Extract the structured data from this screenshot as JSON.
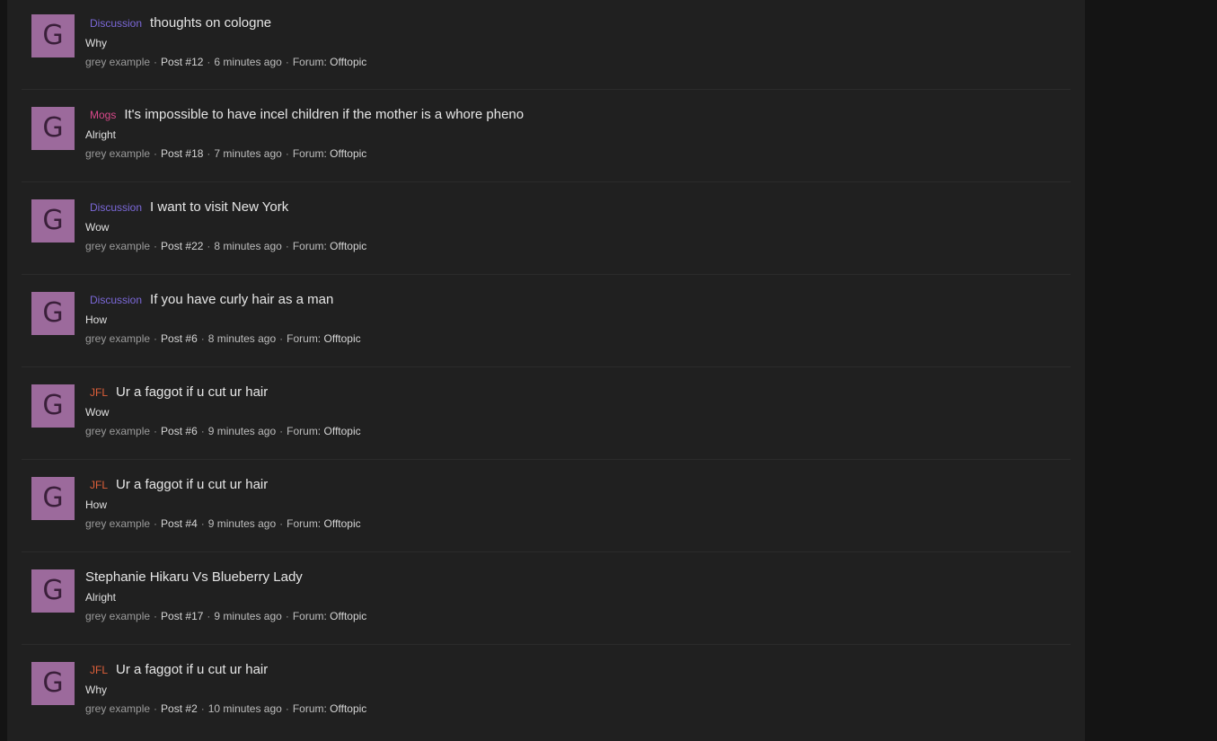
{
  "colors": {
    "page_background": "#141414",
    "panel_background": "#202020",
    "avatar_background": "#9c6a9c",
    "prefix_discussion": "#7b68d8",
    "prefix_mogs": "#d8488a",
    "prefix_jfl": "#e0603a"
  },
  "results": [
    {
      "avatar_letter": "G",
      "prefix": "Discussion",
      "prefix_type": "discussion",
      "title": "thoughts on cologne",
      "snippet": "Why",
      "author": "grey example",
      "post": "Post #12",
      "time": "6 minutes ago",
      "forum_label": "Forum:",
      "forum": "Offtopic"
    },
    {
      "avatar_letter": "G",
      "prefix": "Mogs",
      "prefix_type": "mogs",
      "title": "It's impossible to have incel children if the mother is a whore pheno",
      "snippet": "Alright",
      "author": "grey example",
      "post": "Post #18",
      "time": "7 minutes ago",
      "forum_label": "Forum:",
      "forum": "Offtopic"
    },
    {
      "avatar_letter": "G",
      "prefix": "Discussion",
      "prefix_type": "discussion",
      "title": "I want to visit New York",
      "snippet": "Wow",
      "author": "grey example",
      "post": "Post #22",
      "time": "8 minutes ago",
      "forum_label": "Forum:",
      "forum": "Offtopic"
    },
    {
      "avatar_letter": "G",
      "prefix": "Discussion",
      "prefix_type": "discussion",
      "title": "If you have curly hair as a man",
      "snippet": "How",
      "author": "grey example",
      "post": "Post #6",
      "time": "8 minutes ago",
      "forum_label": "Forum:",
      "forum": "Offtopic"
    },
    {
      "avatar_letter": "G",
      "prefix": "JFL",
      "prefix_type": "jfl",
      "title": "Ur a faggot if u cut ur hair",
      "snippet": "Wow",
      "author": "grey example",
      "post": "Post #6",
      "time": "9 minutes ago",
      "forum_label": "Forum:",
      "forum": "Offtopic"
    },
    {
      "avatar_letter": "G",
      "prefix": "JFL",
      "prefix_type": "jfl",
      "title": "Ur a faggot if u cut ur hair",
      "snippet": "How",
      "author": "grey example",
      "post": "Post #4",
      "time": "9 minutes ago",
      "forum_label": "Forum:",
      "forum": "Offtopic"
    },
    {
      "avatar_letter": "G",
      "prefix": "",
      "prefix_type": "none",
      "title": "Stephanie Hikaru Vs Blueberry Lady",
      "snippet": "Alright",
      "author": "grey example",
      "post": "Post #17",
      "time": "9 minutes ago",
      "forum_label": "Forum:",
      "forum": "Offtopic"
    },
    {
      "avatar_letter": "G",
      "prefix": "JFL",
      "prefix_type": "jfl",
      "title": "Ur a faggot if u cut ur hair",
      "snippet": "Why",
      "author": "grey example",
      "post": "Post #2",
      "time": "10 minutes ago",
      "forum_label": "Forum:",
      "forum": "Offtopic"
    }
  ]
}
